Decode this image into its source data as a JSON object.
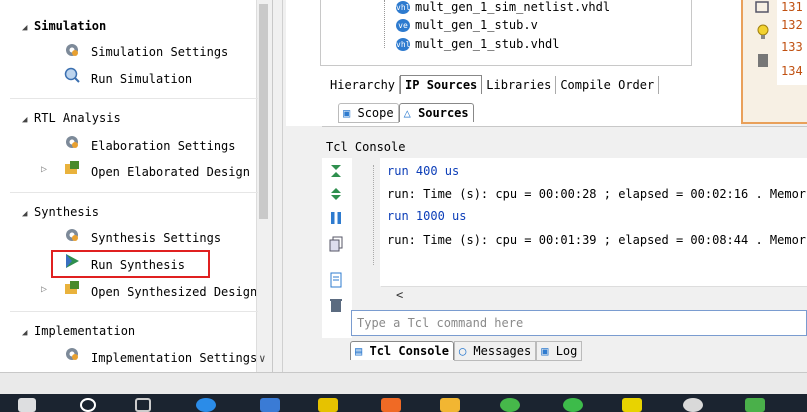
{
  "flow_navigator": {
    "sections": [
      {
        "label": "Simulation",
        "items": [
          {
            "label": "Simulation Settings",
            "icon": "gear-icon"
          },
          {
            "label": "Run Simulation",
            "icon": "magnifier-icon"
          }
        ]
      },
      {
        "label": "RTL Analysis",
        "items": [
          {
            "label": "Elaboration Settings",
            "icon": "gear-icon"
          },
          {
            "label": "Open Elaborated Design",
            "icon": "open-design-icon"
          }
        ]
      },
      {
        "label": "Synthesis",
        "items": [
          {
            "label": "Synthesis Settings",
            "icon": "gear-icon"
          },
          {
            "label": "Run Synthesis",
            "icon": "play-icon"
          },
          {
            "label": "Open Synthesized Design",
            "icon": "open-design-icon"
          }
        ]
      },
      {
        "label": "Implementation",
        "items": [
          {
            "label": "Implementation Settings",
            "icon": "gear-icon"
          }
        ]
      }
    ]
  },
  "sources": {
    "files": [
      "mult_gen_1_sim_netlist.vhdl",
      "mult_gen_1_stub.v",
      "mult_gen_1_stub.vhdl"
    ],
    "file_badges": [
      "vhl",
      "ve",
      "vhl"
    ],
    "tabs": [
      "Hierarchy",
      "IP Sources",
      "Libraries",
      "Compile Order"
    ],
    "active_tab": "IP Sources",
    "view_tabs": [
      "Scope",
      "Sources"
    ],
    "active_view_tab": "Sources"
  },
  "editor": {
    "line_numbers": [
      "131",
      "132",
      "133",
      "134"
    ]
  },
  "tcl_console": {
    "title": "Tcl Console",
    "lines": [
      "run 400 us",
      "run: Time (s): cpu = 00:00:28 ; elapsed = 00:02:16 . Memor",
      "run 1000 us",
      "run: Time (s): cpu = 00:01:39 ; elapsed = 00:08:44 . Memor"
    ],
    "input_placeholder": "Type a Tcl command here",
    "bottom_tabs": [
      "Tcl Console",
      "Messages",
      "Log"
    ],
    "active_bottom_tab": "Tcl Console"
  },
  "colors": {
    "highlight_box": "#e02020",
    "command_text": "#0b3db8",
    "line_number": "#c05010",
    "editor_border": "#e9a05a"
  }
}
